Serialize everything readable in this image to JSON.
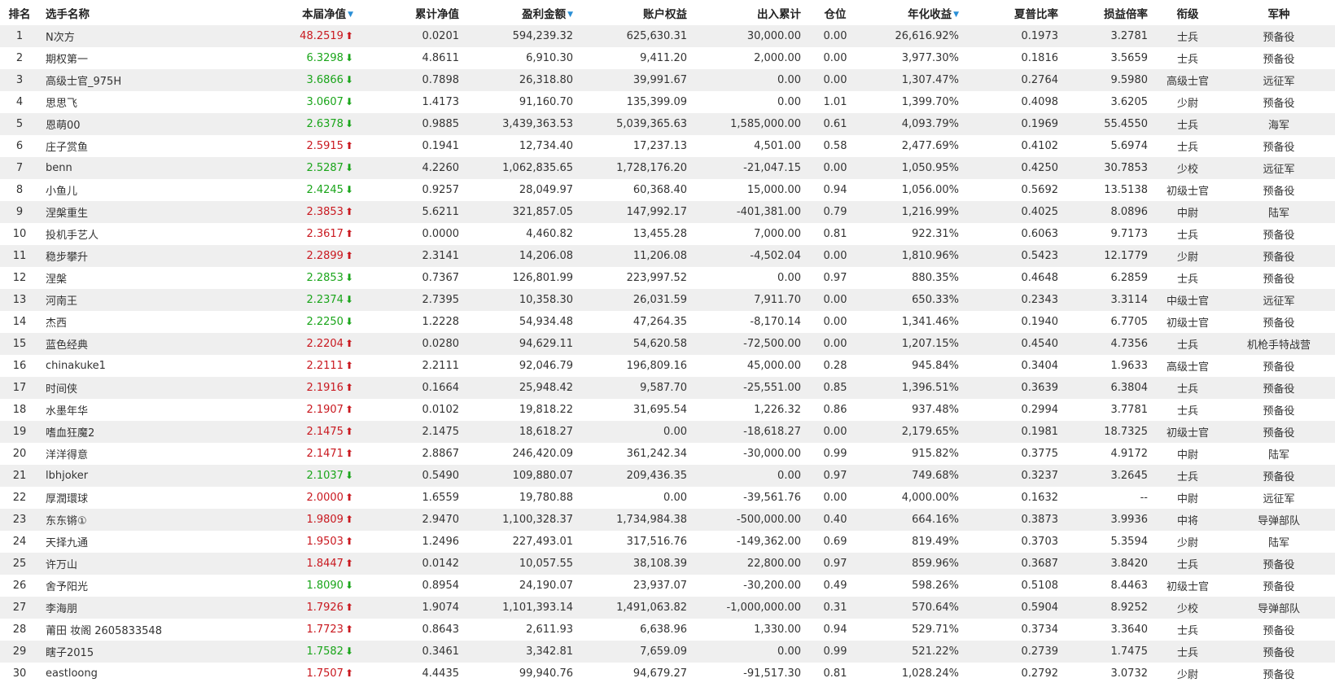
{
  "colors": {
    "up": "#c9181f",
    "down": "#1aa51a",
    "sort_indicator": "#2a8fd6",
    "row_stripe": "#efefef"
  },
  "headers": {
    "rank": "排名",
    "name": "选手名称",
    "nav": "本届净值",
    "cum_nav": "累计净值",
    "profit": "盈利金额",
    "equity": "账户权益",
    "flow": "出入累计",
    "position": "仓位",
    "annual": "年化收益",
    "sharpe": "夏普比率",
    "pl_ratio": "损益倍率",
    "rank_title": "衔级",
    "branch": "军种"
  },
  "sort_icon_glyph": "▼",
  "up_arrow_glyph": "🠅",
  "rows": [
    {
      "rank": "1",
      "name": "N次方",
      "nav": "48.2519",
      "trend": "up",
      "cum_nav": "0.0201",
      "profit": "594,239.32",
      "equity": "625,630.31",
      "flow": "30,000.00",
      "position": "0.00",
      "annual": "26,616.92%",
      "sharpe": "0.1973",
      "pl_ratio": "3.2781",
      "title": "士兵",
      "branch": "预备役"
    },
    {
      "rank": "2",
      "name": "期权第一",
      "nav": "6.3298",
      "trend": "down",
      "cum_nav": "4.8611",
      "profit": "6,910.30",
      "equity": "9,411.20",
      "flow": "2,000.00",
      "position": "0.00",
      "annual": "3,977.30%",
      "sharpe": "0.1816",
      "pl_ratio": "3.5659",
      "title": "士兵",
      "branch": "预备役"
    },
    {
      "rank": "3",
      "name": "高级士官_975H",
      "nav": "3.6866",
      "trend": "down",
      "cum_nav": "0.7898",
      "profit": "26,318.80",
      "equity": "39,991.67",
      "flow": "0.00",
      "position": "0.00",
      "annual": "1,307.47%",
      "sharpe": "0.2764",
      "pl_ratio": "9.5980",
      "title": "高级士官",
      "branch": "远征军"
    },
    {
      "rank": "4",
      "name": "思思飞",
      "nav": "3.0607",
      "trend": "down",
      "cum_nav": "1.4173",
      "profit": "91,160.70",
      "equity": "135,399.09",
      "flow": "0.00",
      "position": "1.01",
      "annual": "1,399.70%",
      "sharpe": "0.4098",
      "pl_ratio": "3.6205",
      "title": "少尉",
      "branch": "预备役"
    },
    {
      "rank": "5",
      "name": "恩萌00",
      "nav": "2.6378",
      "trend": "down",
      "cum_nav": "0.9885",
      "profit": "3,439,363.53",
      "equity": "5,039,365.63",
      "flow": "1,585,000.00",
      "position": "0.61",
      "annual": "4,093.79%",
      "sharpe": "0.1969",
      "pl_ratio": "55.4550",
      "title": "士兵",
      "branch": "海军"
    },
    {
      "rank": "6",
      "name": "庄子赏鱼",
      "nav": "2.5915",
      "trend": "up",
      "cum_nav": "0.1941",
      "profit": "12,734.40",
      "equity": "17,237.13",
      "flow": "4,501.00",
      "position": "0.58",
      "annual": "2,477.69%",
      "sharpe": "0.4102",
      "pl_ratio": "5.6974",
      "title": "士兵",
      "branch": "预备役"
    },
    {
      "rank": "7",
      "name": "benn",
      "nav": "2.5287",
      "trend": "down",
      "cum_nav": "4.2260",
      "profit": "1,062,835.65",
      "equity": "1,728,176.20",
      "flow": "-21,047.15",
      "position": "0.00",
      "annual": "1,050.95%",
      "sharpe": "0.4250",
      "pl_ratio": "30.7853",
      "title": "少校",
      "branch": "远征军"
    },
    {
      "rank": "8",
      "name": "小鱼儿",
      "nav": "2.4245",
      "trend": "down",
      "cum_nav": "0.9257",
      "profit": "28,049.97",
      "equity": "60,368.40",
      "flow": "15,000.00",
      "position": "0.94",
      "annual": "1,056.00%",
      "sharpe": "0.5692",
      "pl_ratio": "13.5138",
      "title": "初级士官",
      "branch": "预备役"
    },
    {
      "rank": "9",
      "name": "涅槃重生",
      "nav": "2.3853",
      "trend": "up",
      "cum_nav": "5.6211",
      "profit": "321,857.05",
      "equity": "147,992.17",
      "flow": "-401,381.00",
      "position": "0.79",
      "annual": "1,216.99%",
      "sharpe": "0.4025",
      "pl_ratio": "8.0896",
      "title": "中尉",
      "branch": "陆军"
    },
    {
      "rank": "10",
      "name": "投机手艺人",
      "nav": "2.3617",
      "trend": "up",
      "cum_nav": "0.0000",
      "profit": "4,460.82",
      "equity": "13,455.28",
      "flow": "7,000.00",
      "position": "0.81",
      "annual": "922.31%",
      "sharpe": "0.6063",
      "pl_ratio": "9.7173",
      "title": "士兵",
      "branch": "预备役"
    },
    {
      "rank": "11",
      "name": "稳步攀升",
      "nav": "2.2899",
      "trend": "up",
      "cum_nav": "2.3141",
      "profit": "14,206.08",
      "equity": "11,206.08",
      "flow": "-4,502.04",
      "position": "0.00",
      "annual": "1,810.96%",
      "sharpe": "0.5423",
      "pl_ratio": "12.1779",
      "title": "少尉",
      "branch": "预备役"
    },
    {
      "rank": "12",
      "name": "涅槃",
      "nav": "2.2853",
      "trend": "down",
      "cum_nav": "0.7367",
      "profit": "126,801.99",
      "equity": "223,997.52",
      "flow": "0.00",
      "position": "0.97",
      "annual": "880.35%",
      "sharpe": "0.4648",
      "pl_ratio": "6.2859",
      "title": "士兵",
      "branch": "预备役"
    },
    {
      "rank": "13",
      "name": "河南王",
      "nav": "2.2374",
      "trend": "down",
      "cum_nav": "2.7395",
      "profit": "10,358.30",
      "equity": "26,031.59",
      "flow": "7,911.70",
      "position": "0.00",
      "annual": "650.33%",
      "sharpe": "0.2343",
      "pl_ratio": "3.3114",
      "title": "中级士官",
      "branch": "远征军"
    },
    {
      "rank": "14",
      "name": "杰西",
      "nav": "2.2250",
      "trend": "down",
      "cum_nav": "1.2228",
      "profit": "54,934.48",
      "equity": "47,264.35",
      "flow": "-8,170.14",
      "position": "0.00",
      "annual": "1,341.46%",
      "sharpe": "0.1940",
      "pl_ratio": "6.7705",
      "title": "初级士官",
      "branch": "预备役"
    },
    {
      "rank": "15",
      "name": "蓝色经典",
      "nav": "2.2204",
      "trend": "up",
      "cum_nav": "0.0280",
      "profit": "94,629.11",
      "equity": "54,620.58",
      "flow": "-72,500.00",
      "position": "0.00",
      "annual": "1,207.15%",
      "sharpe": "0.4540",
      "pl_ratio": "4.7356",
      "title": "士兵",
      "branch": "机枪手特战营"
    },
    {
      "rank": "16",
      "name": "chinakuke1",
      "nav": "2.2111",
      "trend": "up",
      "cum_nav": "2.2111",
      "profit": "92,046.79",
      "equity": "196,809.16",
      "flow": "45,000.00",
      "position": "0.28",
      "annual": "945.84%",
      "sharpe": "0.3404",
      "pl_ratio": "1.9633",
      "title": "高级士官",
      "branch": "预备役"
    },
    {
      "rank": "17",
      "name": "时间侠",
      "nav": "2.1916",
      "trend": "up",
      "cum_nav": "0.1664",
      "profit": "25,948.42",
      "equity": "9,587.70",
      "flow": "-25,551.00",
      "position": "0.85",
      "annual": "1,396.51%",
      "sharpe": "0.3639",
      "pl_ratio": "6.3804",
      "title": "士兵",
      "branch": "预备役"
    },
    {
      "rank": "18",
      "name": "水墨年华",
      "nav": "2.1907",
      "trend": "up",
      "cum_nav": "0.0102",
      "profit": "19,818.22",
      "equity": "31,695.54",
      "flow": "1,226.32",
      "position": "0.86",
      "annual": "937.48%",
      "sharpe": "0.2994",
      "pl_ratio": "3.7781",
      "title": "士兵",
      "branch": "预备役"
    },
    {
      "rank": "19",
      "name": "嗜血狂魔2",
      "nav": "2.1475",
      "trend": "up",
      "cum_nav": "2.1475",
      "profit": "18,618.27",
      "equity": "0.00",
      "flow": "-18,618.27",
      "position": "0.00",
      "annual": "2,179.65%",
      "sharpe": "0.1981",
      "pl_ratio": "18.7325",
      "title": "初级士官",
      "branch": "预备役"
    },
    {
      "rank": "20",
      "name": "洋洋得意",
      "nav": "2.1471",
      "trend": "up",
      "cum_nav": "2.8867",
      "profit": "246,420.09",
      "equity": "361,242.34",
      "flow": "-30,000.00",
      "position": "0.99",
      "annual": "915.82%",
      "sharpe": "0.3775",
      "pl_ratio": "4.9172",
      "title": "中尉",
      "branch": "陆军"
    },
    {
      "rank": "21",
      "name": "lbhjoker",
      "nav": "2.1037",
      "trend": "down",
      "cum_nav": "0.5490",
      "profit": "109,880.07",
      "equity": "209,436.35",
      "flow": "0.00",
      "position": "0.97",
      "annual": "749.68%",
      "sharpe": "0.3237",
      "pl_ratio": "3.2645",
      "title": "士兵",
      "branch": "预备役"
    },
    {
      "rank": "22",
      "name": "厚潤環球",
      "nav": "2.0000",
      "trend": "up",
      "cum_nav": "1.6559",
      "profit": "19,780.88",
      "equity": "0.00",
      "flow": "-39,561.76",
      "position": "0.00",
      "annual": "4,000.00%",
      "sharpe": "0.1632",
      "pl_ratio": "--",
      "title": "中尉",
      "branch": "远征军"
    },
    {
      "rank": "23",
      "name": "东东锵①",
      "nav": "1.9809",
      "trend": "up",
      "cum_nav": "2.9470",
      "profit": "1,100,328.37",
      "equity": "1,734,984.38",
      "flow": "-500,000.00",
      "position": "0.40",
      "annual": "664.16%",
      "sharpe": "0.3873",
      "pl_ratio": "3.9936",
      "title": "中将",
      "branch": "导弹部队"
    },
    {
      "rank": "24",
      "name": "天择九通",
      "nav": "1.9503",
      "trend": "up",
      "cum_nav": "1.2496",
      "profit": "227,493.01",
      "equity": "317,516.76",
      "flow": "-149,362.00",
      "position": "0.69",
      "annual": "819.49%",
      "sharpe": "0.3703",
      "pl_ratio": "5.3594",
      "title": "少尉",
      "branch": "陆军"
    },
    {
      "rank": "25",
      "name": "许万山",
      "nav": "1.8447",
      "trend": "up",
      "cum_nav": "0.0142",
      "profit": "10,057.55",
      "equity": "38,108.39",
      "flow": "22,800.00",
      "position": "0.97",
      "annual": "859.96%",
      "sharpe": "0.3687",
      "pl_ratio": "3.8420",
      "title": "士兵",
      "branch": "预备役"
    },
    {
      "rank": "26",
      "name": "舍予阳光",
      "nav": "1.8090",
      "trend": "down",
      "cum_nav": "0.8954",
      "profit": "24,190.07",
      "equity": "23,937.07",
      "flow": "-30,200.00",
      "position": "0.49",
      "annual": "598.26%",
      "sharpe": "0.5108",
      "pl_ratio": "8.4463",
      "title": "初级士官",
      "branch": "预备役"
    },
    {
      "rank": "27",
      "name": "李海朋",
      "nav": "1.7926",
      "trend": "up",
      "cum_nav": "1.9074",
      "profit": "1,101,393.14",
      "equity": "1,491,063.82",
      "flow": "-1,000,000.00",
      "position": "0.31",
      "annual": "570.64%",
      "sharpe": "0.5904",
      "pl_ratio": "8.9252",
      "title": "少校",
      "branch": "导弹部队"
    },
    {
      "rank": "28",
      "name": "莆田 妆阁 2605833548",
      "nav": "1.7723",
      "trend": "up",
      "cum_nav": "0.8643",
      "profit": "2,611.93",
      "equity": "6,638.96",
      "flow": "1,330.00",
      "position": "0.94",
      "annual": "529.71%",
      "sharpe": "0.3734",
      "pl_ratio": "3.3640",
      "title": "士兵",
      "branch": "预备役"
    },
    {
      "rank": "29",
      "name": "瞎子2015",
      "nav": "1.7582",
      "trend": "down",
      "cum_nav": "0.3461",
      "profit": "3,342.81",
      "equity": "7,659.09",
      "flow": "0.00",
      "position": "0.99",
      "annual": "521.22%",
      "sharpe": "0.2739",
      "pl_ratio": "1.7475",
      "title": "士兵",
      "branch": "预备役"
    },
    {
      "rank": "30",
      "name": "eastloong",
      "nav": "1.7507",
      "trend": "up",
      "cum_nav": "4.4435",
      "profit": "99,940.76",
      "equity": "94,679.27",
      "flow": "-91,517.30",
      "position": "0.81",
      "annual": "1,028.24%",
      "sharpe": "0.2792",
      "pl_ratio": "3.0732",
      "title": "少尉",
      "branch": "预备役"
    }
  ]
}
